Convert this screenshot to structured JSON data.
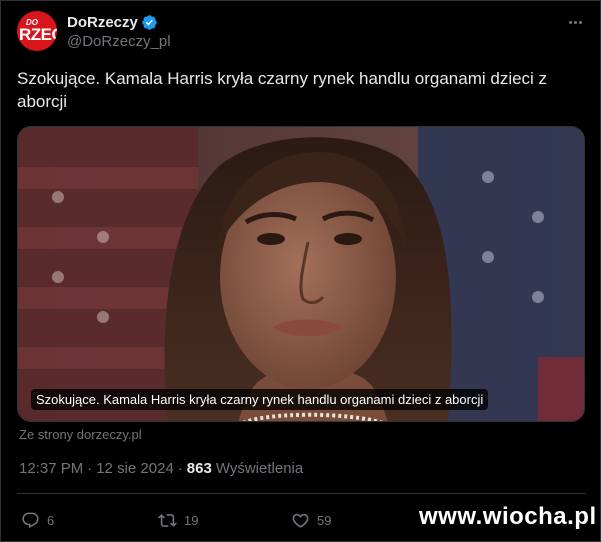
{
  "account": {
    "display_name": "DoRzeczy",
    "handle": "@DoRzeczy_pl",
    "avatar_text_top": "DO",
    "avatar_text_main": "RZEC",
    "verified": true
  },
  "tweet": {
    "text": "Szokujące. Kamala Harris kryła czarny rynek handlu organami dzieci z aborcji"
  },
  "media": {
    "caption": "Szokujące. Kamala Harris kryła czarny rynek handlu organami dzieci z aborcji",
    "source": "Ze strony dorzeczy.pl"
  },
  "meta": {
    "time": "12:37 PM",
    "separator": "·",
    "date": "12 sie 2024",
    "separator2": "·",
    "views_count": "863",
    "views_label": "Wyświetlenia"
  },
  "actions": {
    "replies": "6",
    "reposts": "19",
    "likes": "59"
  },
  "watermark": "www.wiocha.pl",
  "colors": {
    "background": "#000000",
    "text_primary": "#e7e9ea",
    "text_secondary": "#71767b",
    "verified_blue": "#1d9bf0",
    "brand_red": "#d9141b",
    "border": "#2f3336"
  },
  "icons": [
    "verified-badge-icon",
    "more-icon",
    "reply-icon",
    "repost-icon",
    "like-icon"
  ]
}
